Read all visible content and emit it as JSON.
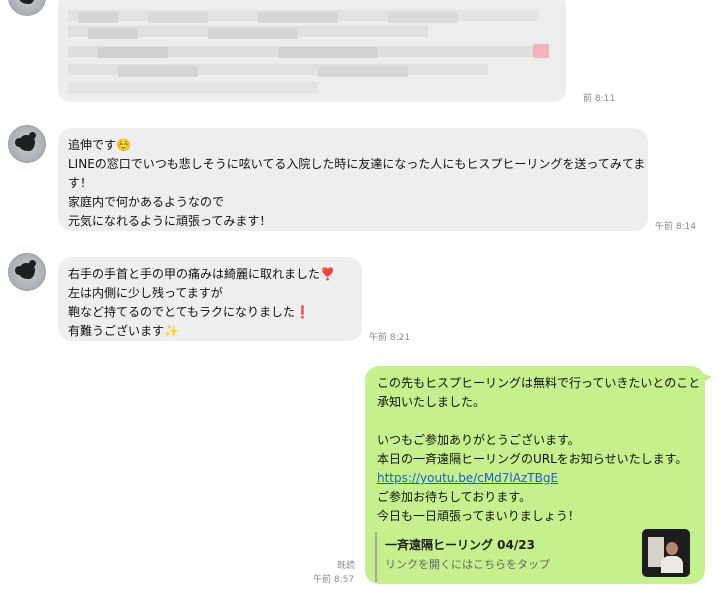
{
  "chat": {
    "msg0": {
      "time": "前 8:11"
    },
    "msg1": {
      "lines": [
        "追伸です",
        "LINEの窓口でいつも悲しそうに呟いてる入院した時に友達になった人にもヒスプヒーリングを送ってみてま",
        "す！",
        "家庭内で何かあるようなので",
        "元気になれるように頑張ってみます！"
      ],
      "emoji": "☺️",
      "time": "午前 8:14"
    },
    "msg2": {
      "lines": [
        "右手の手首と手の甲の痛みは綺麗に取れました",
        "左は内側に少し残ってますが",
        "鞄など持てるのでとてもラクになりました",
        "有難うございます"
      ],
      "emoji_heart": "❣️",
      "emoji_exclaim": "❗",
      "emoji_sparkle": "✨",
      "time": "午前 8:21"
    },
    "msg3": {
      "lines": [
        "この先もヒスプヒーリングは無料で行っていきたいとのこと",
        "承知いたしました。",
        "",
        "いつもご参加ありがとうございます。",
        "本日の一斉遠隔ヒーリングのURLをお知らせいたします。"
      ],
      "link": "https://youtu.be/cMd7lAzTBgE",
      "lines_after": [
        "ご参加お待ちしております。",
        "今日も一日頑張ってまいりましょう！"
      ],
      "preview_title": "一斉遠隔ヒーリング 04/23",
      "preview_subtitle": "リンクを開くにはこちらをタップ",
      "read_status": "既読",
      "time": "午前 8:57"
    }
  }
}
